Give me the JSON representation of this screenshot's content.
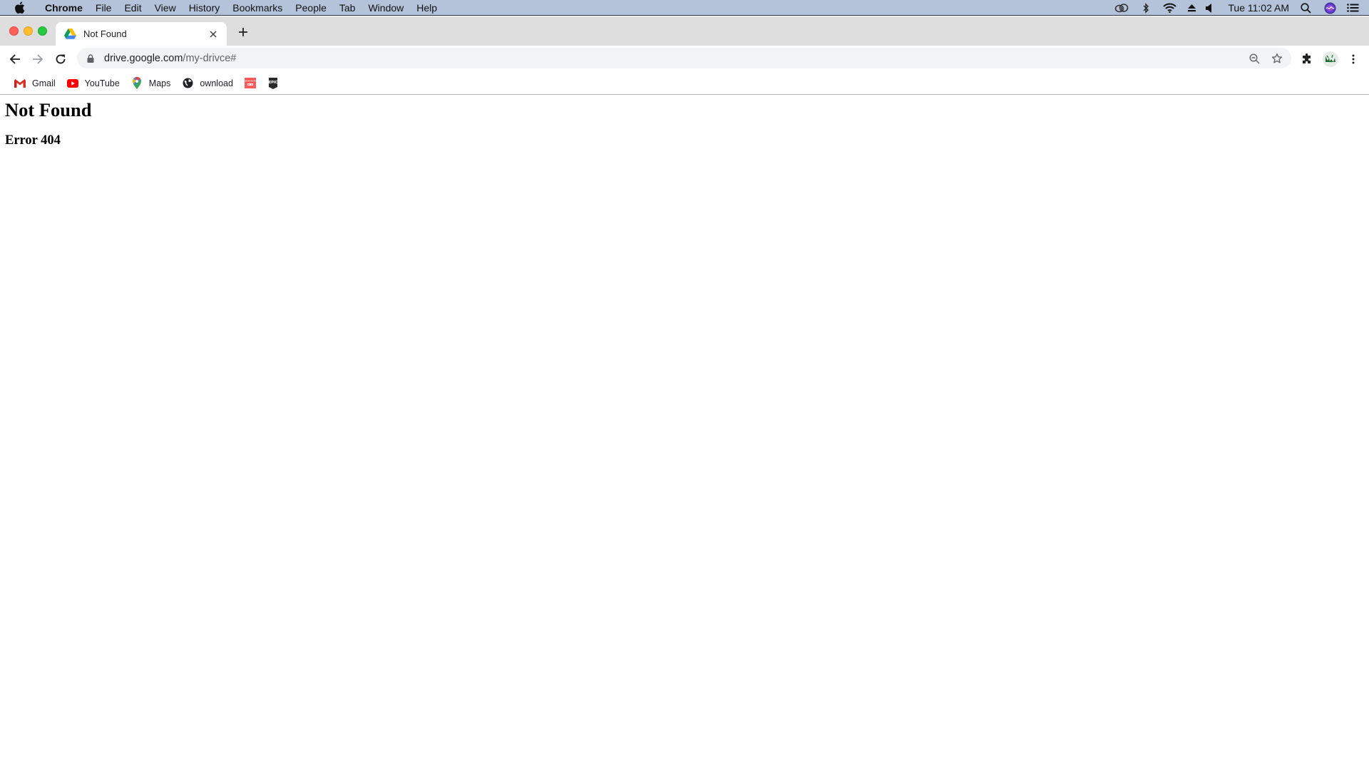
{
  "menubar": {
    "app_name": "Chrome",
    "items": [
      "File",
      "Edit",
      "View",
      "History",
      "Bookmarks",
      "People",
      "Tab",
      "Window",
      "Help"
    ],
    "status_icons": [
      "creative-cloud-icon",
      "bluetooth-icon",
      "wifi-icon",
      "eject-icon",
      "volume-icon"
    ],
    "clock": "Tue 11:02 AM"
  },
  "tabs": [
    {
      "title": "Not Found",
      "favicon": "google-drive-icon",
      "active": true
    }
  ],
  "toolbar": {
    "url_host": "drive.google.com",
    "url_path": "/my-drivce#"
  },
  "bookmarks": [
    {
      "label": "Gmail",
      "icon": "gmail-icon"
    },
    {
      "label": "YouTube",
      "icon": "youtube-icon"
    },
    {
      "label": "Maps",
      "icon": "google-maps-icon"
    },
    {
      "label": "ownload",
      "icon": "globe-icon"
    },
    {
      "label": "",
      "icon": "game-store-icon"
    },
    {
      "label": "",
      "icon": "epic-games-icon"
    }
  ],
  "page": {
    "heading": "Not Found",
    "subheading": "Error 404"
  },
  "colors": {
    "menubar_bg": "#b4c3d9",
    "tabstrip_bg": "#dedede",
    "omnibox_bg": "#f1f3f4",
    "close": "#fe5f57",
    "minimize": "#febc2e",
    "maximize": "#28c840"
  }
}
